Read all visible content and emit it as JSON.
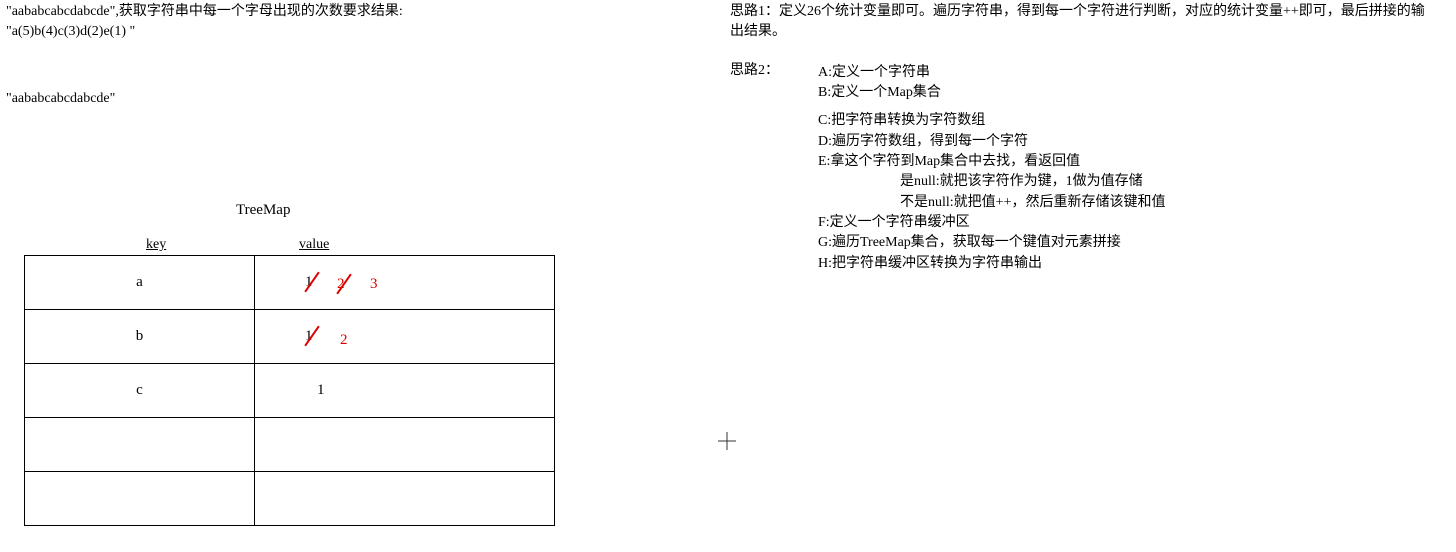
{
  "left": {
    "problem_line1": "\"aababcabcdabcde\",获取字符串中每一个字母出现的次数要求结果:",
    "problem_line2": "\"a(5)b(4)c(3)d(2)e(1) \"",
    "sample": "\"aababcabcdabcde\"",
    "table_title": "TreeMap",
    "header_key": "key",
    "header_value": "value",
    "rows": [
      {
        "key": "a",
        "v1": "1",
        "v2": "2",
        "v3": "3"
      },
      {
        "key": "b",
        "v1": "1",
        "v2": "2",
        "v3": ""
      },
      {
        "key": "c",
        "v1": "1",
        "v2": "",
        "v3": ""
      },
      {
        "key": "",
        "v1": "",
        "v2": "",
        "v3": ""
      },
      {
        "key": "",
        "v1": "",
        "v2": "",
        "v3": ""
      }
    ]
  },
  "right": {
    "idea1": "思路1：定义26个统计变量即可。遍历字符串，得到每一个字符进行判断，对应的统计变量++即可，最后拼接的输出结果。",
    "idea2_label": "思路2：",
    "steps": {
      "a": "A:定义一个字符串",
      "b": "B:定义一个Map集合",
      "c": "C:把字符串转换为字符数组",
      "d": "D:遍历字符数组，得到每一个字符",
      "e": "E:拿这个字符到Map集合中去找，看返回值",
      "e1": "是null:就把该字符作为键，1做为值存储",
      "e2": "不是null:就把值++，然后重新存储该键和值",
      "f": "F:定义一个字符串缓冲区",
      "g": "G:遍历TreeMap集合，获取每一个键值对元素拼接",
      "h": "H:把字符串缓冲区转换为字符串输出"
    }
  },
  "chart_data": {
    "type": "table",
    "title": "TreeMap",
    "columns": [
      "key",
      "value"
    ],
    "rows": [
      {
        "key": "a",
        "value_sequence": [
          1,
          2,
          3
        ],
        "current": 3
      },
      {
        "key": "b",
        "value_sequence": [
          1,
          2
        ],
        "current": 2
      },
      {
        "key": "c",
        "value_sequence": [
          1
        ],
        "current": 1
      }
    ],
    "note": "crossed-out values in red show incremented counts"
  }
}
